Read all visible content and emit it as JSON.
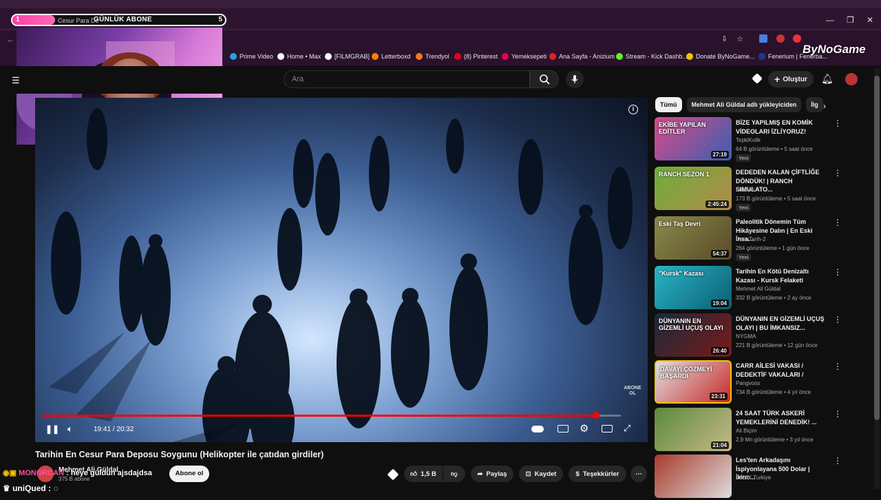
{
  "overlay": {
    "goal_start": "1",
    "goal_label": "GÜNLÜK ABONE",
    "goal_end": "5",
    "goal_progress": 0.2,
    "tab_title": "Cesur Para De",
    "brand": "ByNoGame"
  },
  "browser": {
    "bookmarks": [
      {
        "label": "Prime Video",
        "color": "#1fa3e0"
      },
      {
        "label": "Home • Max",
        "color": "#ffffff"
      },
      {
        "label": "[FILMGRAB]",
        "color": "#ffffff"
      },
      {
        "label": "Letterboxd",
        "color": "#ff8000"
      },
      {
        "label": "Trendyol",
        "color": "#f27a1a"
      },
      {
        "label": "(8) Pinterest",
        "color": "#e60023"
      },
      {
        "label": "Yemeksepeti",
        "color": "#ea004b"
      },
      {
        "label": "Ana Sayfa - Anizium",
        "color": "#d22"
      },
      {
        "label": "Stream - Kick Dashb...",
        "color": "#53fc18"
      },
      {
        "label": "Donate ByNoGame...",
        "color": "#f5c400"
      },
      {
        "label": "Fenerium | Fenerba...",
        "color": "#1a3a8f"
      }
    ]
  },
  "header": {
    "search_placeholder": "Ara",
    "create_label": "Oluştur"
  },
  "player": {
    "time": "19:41 / 20:32",
    "progress": 0.957,
    "abone_ol": "ABONE OL"
  },
  "video": {
    "title": "Tarihin En Cesur Para Deposu Soygunu (Helikopter ile çatıdan girdiler)",
    "channel": "Mehmet Ali Güldal",
    "subscribers": "375 B abone",
    "subscribe_label": "Abone ol",
    "likes": "1,5 B",
    "share_label": "Paylaş",
    "save_label": "Kaydet",
    "thanks_label": "Teşekkürler"
  },
  "chat": {
    "user1": "MONGRCAN",
    "msg1": ": heye güldün ajsdajdsa",
    "user2": "uniQued",
    "msg2": ":"
  },
  "sidebar": {
    "chips": [
      "Tümü",
      "Mehmet Ali Güldal adlı yükleyiciden",
      "İlg"
    ],
    "recs": [
      {
        "title": "BİZE YAPILMIŞ EN KOMİK VİDEOLARI İZLİYORUZ!",
        "channel": "TepkiKolik",
        "meta": "64 B görüntüleme • 5 saat önce",
        "badge": "Yeni",
        "duration": "27:19",
        "thumb_text": "EKİBE YAPILAN EDİTLER",
        "color1": "#d94a8a",
        "color2": "#3a5fb0"
      },
      {
        "title": "DEDEDEN KALAN ÇİFTLİĞE DÖNDÜK! | RANCH SIMULATO...",
        "channel": "Elraenn",
        "meta": "173 B görüntüleme • 5 saat önce",
        "badge": "Yeni",
        "duration": "2:45:24",
        "thumb_text": "RANCH SEZON 1",
        "color1": "#6fae3a",
        "color2": "#b28a4a"
      },
      {
        "title": "Paleolitik Dönemin Tüm Hikâyesine Dalın | En Eski İnsa...",
        "channel": "DerinTarih-2",
        "meta": "264 görüntüleme • 1 gün önce",
        "badge": "Yeni",
        "duration": "54:37",
        "thumb_text": "Eski Taş Devri",
        "color1": "#8a8a4a",
        "color2": "#5a4a2a"
      },
      {
        "title": "Tarihin En Kötü Denizaltı Kazası - Kursk Felaketi",
        "channel": "Mehmet Ali Güldal",
        "meta": "332 B görüntüleme • 2 ay önce",
        "badge": "",
        "duration": "19:04",
        "thumb_text": "\"Kursk\" Kazası",
        "color1": "#2ab5c8",
        "color2": "#0a5f70"
      },
      {
        "title": "DÜNYANIN EN GİZEMLİ UÇUŞ OLAYI | BU İMKANSIZ...",
        "channel": "NYGMA",
        "meta": "221 B görüntüleme • 12 gün önce",
        "badge": "",
        "duration": "26:40",
        "thumb_text": "DÜNYANIN EN GİZEMLİ UÇUŞ OLAYI",
        "color1": "#1a2a3a",
        "color2": "#7a1a1a"
      },
      {
        "title": "CARR AİLESİ VAKASI / DEDEKTİF VAKALARI /",
        "channel": "Pangvoss",
        "meta": "734 B görüntüleme • 4 yıl önce",
        "badge": "",
        "duration": "23:31",
        "thumb_text": "DAVAYI ÇÖZMEYİ BAŞARDI",
        "color1": "#e0e0e0",
        "color2": "#c82a2a"
      },
      {
        "title": "24 SAAT TÜRK ASKERİ YEMEKLERİNİ DENEDİK! ...",
        "channel": "Ali Biçim",
        "meta": "2,9 Mn görüntüleme • 3 yıl önce",
        "badge": "",
        "duration": "21:04",
        "thumb_text": "",
        "color1": "#5a8a3a",
        "color2": "#c8b88a"
      },
      {
        "title": "Les'ten Arkadaşını İspiyonlayana 500 Dolar | İkinc...",
        "channel": "DMAX Turkiye",
        "meta": "",
        "badge": "",
        "duration": "",
        "thumb_text": "",
        "color1": "#a83a2a",
        "color2": "#ddd"
      }
    ]
  }
}
